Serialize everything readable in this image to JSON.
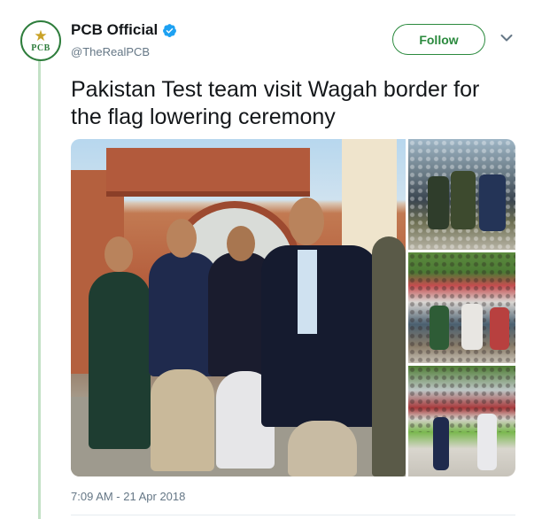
{
  "user": {
    "display_name": "PCB Official",
    "handle": "@TheRealPCB",
    "verified": true,
    "avatar_text": "PCB"
  },
  "follow_label": "Follow",
  "tweet": {
    "text": "Pakistan Test team visit Wagah border for the flag lowering ceremony",
    "timestamp": "7:09 AM - 21 Apr 2018"
  },
  "media": {
    "count": 4
  },
  "icons": {
    "verified": "verified-badge-icon",
    "caret": "chevron-down-icon",
    "avatar_star": "star-icon"
  },
  "colors": {
    "accent": "#2b8a3e",
    "verified": "#1da1f2",
    "thread_line": "#c3e1c6",
    "muted_text": "#657786"
  }
}
